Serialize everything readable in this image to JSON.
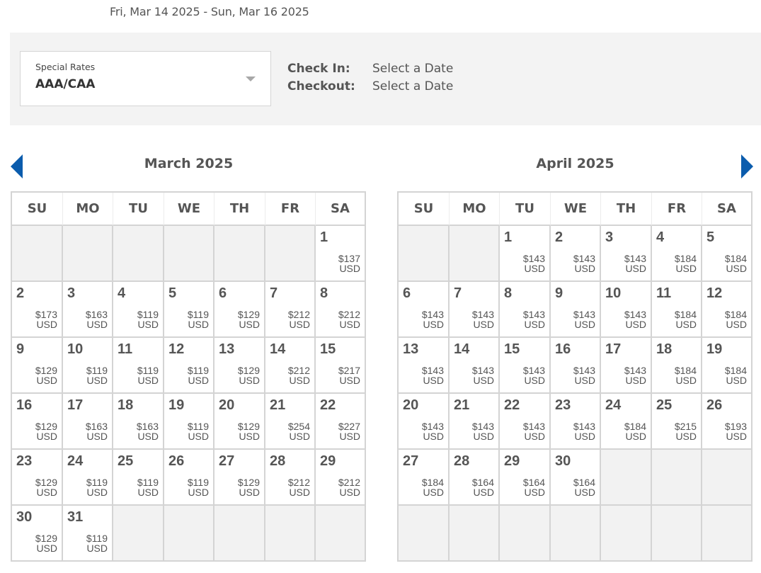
{
  "header": {
    "date_range": "Fri, Mar 14 2025 - Sun, Mar 16 2025"
  },
  "rate_panel": {
    "special_rates_label": "Special Rates",
    "special_rates_value": "AAA/CAA",
    "dropdown_icon": "caret-down-icon",
    "check_in_label": "Check In:",
    "check_in_value": "Select a Date",
    "checkout_label": "Checkout:",
    "checkout_value": "Select a Date"
  },
  "navigation": {
    "prev_icon": "triangle-left-icon",
    "next_icon": "triangle-right-icon",
    "accent_color": "#0b5cad"
  },
  "weekdays": [
    "SU",
    "MO",
    "TU",
    "WE",
    "TH",
    "FR",
    "SA"
  ],
  "months": [
    {
      "title": "March 2025",
      "currency": "USD",
      "weeks": [
        [
          null,
          null,
          null,
          null,
          null,
          null,
          {
            "day": "1",
            "price": "$137"
          }
        ],
        [
          {
            "day": "2",
            "price": "$173"
          },
          {
            "day": "3",
            "price": "$163"
          },
          {
            "day": "4",
            "price": "$119"
          },
          {
            "day": "5",
            "price": "$119"
          },
          {
            "day": "6",
            "price": "$129"
          },
          {
            "day": "7",
            "price": "$212"
          },
          {
            "day": "8",
            "price": "$212"
          }
        ],
        [
          {
            "day": "9",
            "price": "$129"
          },
          {
            "day": "10",
            "price": "$119"
          },
          {
            "day": "11",
            "price": "$119"
          },
          {
            "day": "12",
            "price": "$119"
          },
          {
            "day": "13",
            "price": "$129"
          },
          {
            "day": "14",
            "price": "$212"
          },
          {
            "day": "15",
            "price": "$217"
          }
        ],
        [
          {
            "day": "16",
            "price": "$129"
          },
          {
            "day": "17",
            "price": "$163"
          },
          {
            "day": "18",
            "price": "$163"
          },
          {
            "day": "19",
            "price": "$119"
          },
          {
            "day": "20",
            "price": "$129"
          },
          {
            "day": "21",
            "price": "$254"
          },
          {
            "day": "22",
            "price": "$227"
          }
        ],
        [
          {
            "day": "23",
            "price": "$129"
          },
          {
            "day": "24",
            "price": "$119"
          },
          {
            "day": "25",
            "price": "$119"
          },
          {
            "day": "26",
            "price": "$119"
          },
          {
            "day": "27",
            "price": "$129"
          },
          {
            "day": "28",
            "price": "$212"
          },
          {
            "day": "29",
            "price": "$212"
          }
        ],
        [
          {
            "day": "30",
            "price": "$129"
          },
          {
            "day": "31",
            "price": "$119"
          },
          null,
          null,
          null,
          null,
          null
        ]
      ]
    },
    {
      "title": "April 2025",
      "currency": "USD",
      "weeks": [
        [
          null,
          null,
          {
            "day": "1",
            "price": "$143"
          },
          {
            "day": "2",
            "price": "$143"
          },
          {
            "day": "3",
            "price": "$143"
          },
          {
            "day": "4",
            "price": "$184"
          },
          {
            "day": "5",
            "price": "$184"
          }
        ],
        [
          {
            "day": "6",
            "price": "$143"
          },
          {
            "day": "7",
            "price": "$143"
          },
          {
            "day": "8",
            "price": "$143"
          },
          {
            "day": "9",
            "price": "$143"
          },
          {
            "day": "10",
            "price": "$143"
          },
          {
            "day": "11",
            "price": "$184"
          },
          {
            "day": "12",
            "price": "$184"
          }
        ],
        [
          {
            "day": "13",
            "price": "$143"
          },
          {
            "day": "14",
            "price": "$143"
          },
          {
            "day": "15",
            "price": "$143"
          },
          {
            "day": "16",
            "price": "$143"
          },
          {
            "day": "17",
            "price": "$143"
          },
          {
            "day": "18",
            "price": "$184"
          },
          {
            "day": "19",
            "price": "$184"
          }
        ],
        [
          {
            "day": "20",
            "price": "$143"
          },
          {
            "day": "21",
            "price": "$143"
          },
          {
            "day": "22",
            "price": "$143"
          },
          {
            "day": "23",
            "price": "$143"
          },
          {
            "day": "24",
            "price": "$184"
          },
          {
            "day": "25",
            "price": "$215"
          },
          {
            "day": "26",
            "price": "$193"
          }
        ],
        [
          {
            "day": "27",
            "price": "$184"
          },
          {
            "day": "28",
            "price": "$164"
          },
          {
            "day": "29",
            "price": "$164"
          },
          {
            "day": "30",
            "price": "$164"
          },
          null,
          null,
          null
        ],
        [
          null,
          null,
          null,
          null,
          null,
          null,
          null
        ]
      ]
    }
  ]
}
